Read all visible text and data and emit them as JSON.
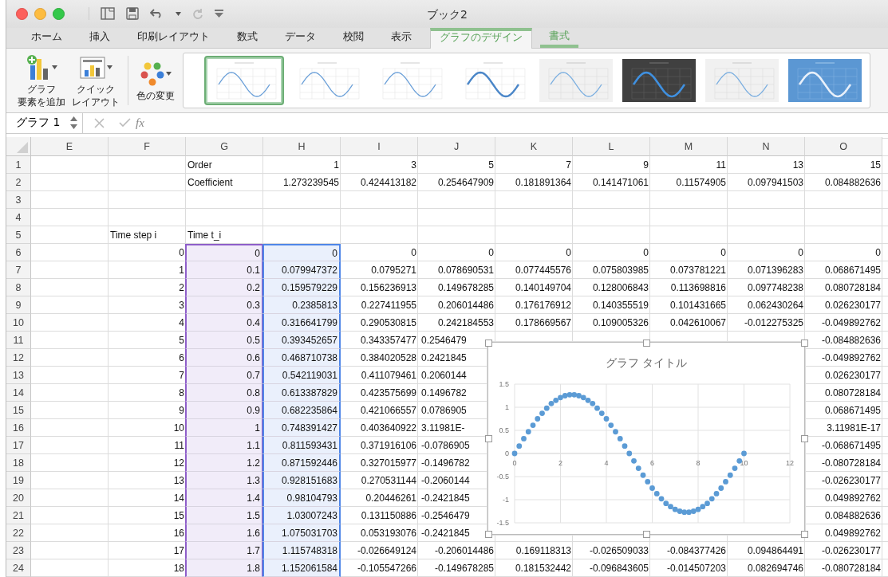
{
  "window": {
    "title": "ブック2"
  },
  "tabs": [
    {
      "label": "ホーム",
      "selected": false,
      "kind": "normal"
    },
    {
      "label": "挿入",
      "selected": false,
      "kind": "normal"
    },
    {
      "label": "印刷レイアウト",
      "selected": false,
      "kind": "normal"
    },
    {
      "label": "数式",
      "selected": false,
      "kind": "normal"
    },
    {
      "label": "データ",
      "selected": false,
      "kind": "normal"
    },
    {
      "label": "校閲",
      "selected": false,
      "kind": "normal"
    },
    {
      "label": "表示",
      "selected": false,
      "kind": "normal"
    },
    {
      "label": "グラフのデザイン",
      "selected": true,
      "kind": "context"
    },
    {
      "label": "書式",
      "selected": false,
      "kind": "context"
    }
  ],
  "ribbon": {
    "buttons": [
      {
        "kind": "add-element",
        "lines": [
          "グラフ",
          "要素を追加"
        ]
      },
      {
        "kind": "quick-layout",
        "lines": [
          "クイック",
          "レイアウト"
        ]
      },
      {
        "kind": "colors",
        "lines": [
          "色の変更"
        ]
      }
    ],
    "styles": [
      {
        "kind": "plain",
        "selected": true
      },
      {
        "kind": "plain",
        "selected": false
      },
      {
        "kind": "plain",
        "selected": false
      },
      {
        "kind": "bold",
        "selected": false
      },
      {
        "kind": "shaded",
        "selected": false
      },
      {
        "kind": "dark",
        "selected": false
      },
      {
        "kind": "shaded",
        "selected": false
      },
      {
        "kind": "blue",
        "selected": false
      }
    ]
  },
  "formula_bar": {
    "name_box": "グラフ 1",
    "fx": "fx"
  },
  "sheet": {
    "columns": [
      {
        "label": "E"
      },
      {
        "label": "F"
      },
      {
        "label": "G",
        "color": "#8e5ec9"
      },
      {
        "label": "H",
        "color": "#4f86e8"
      },
      {
        "label": "I"
      },
      {
        "label": "J"
      },
      {
        "label": "K"
      },
      {
        "label": "L"
      },
      {
        "label": "M"
      },
      {
        "label": "N"
      },
      {
        "label": "O"
      }
    ],
    "rows": [
      {
        "header": "1",
        "cells": {
          "G": {
            "text": "Order",
            "kind": "label"
          },
          "H": "1",
          "I": "3",
          "J": "5",
          "K": "7",
          "L": "9",
          "M": "11",
          "N": "13",
          "O": "15"
        }
      },
      {
        "header": "2",
        "cells": {
          "G": {
            "text": "Coefficient",
            "kind": "label"
          },
          "H": "1.273239545",
          "I": "0.424413182",
          "J": "0.254647909",
          "K": "0.181891364",
          "L": "0.141471061",
          "M": "0.11574905",
          "N": "0.097941503",
          "O": "0.084882636"
        }
      },
      {
        "header": "3",
        "cells": {}
      },
      {
        "header": "4",
        "cells": {}
      },
      {
        "header": "5",
        "cells": {
          "F": {
            "text": "Time step i",
            "kind": "label"
          },
          "G": {
            "text": "Time t_i",
            "kind": "label"
          }
        }
      },
      {
        "header": "6",
        "in_range": true,
        "cells": {
          "F": "0",
          "G": "0",
          "H": "0",
          "I": "0",
          "J": "0",
          "K": "0",
          "L": "0",
          "M": "0",
          "N": "0",
          "O": "0"
        }
      },
      {
        "header": "7",
        "in_range": true,
        "cells": {
          "F": "1",
          "G": "0.1",
          "H": "0.079947372",
          "I": "0.0795271",
          "J": "0.078690531",
          "K": "0.077445576",
          "L": "0.075803985",
          "M": "0.073781221",
          "N": "0.071396283",
          "O": "0.068671495"
        }
      },
      {
        "header": "8",
        "in_range": true,
        "cells": {
          "F": "2",
          "G": "0.2",
          "H": "0.159579229",
          "I": "0.156236913",
          "J": "0.149678285",
          "K": "0.140149704",
          "L": "0.128006843",
          "M": "0.113698816",
          "N": "0.097748238",
          "O": "0.080728184"
        }
      },
      {
        "header": "9",
        "in_range": true,
        "cells": {
          "F": "3",
          "G": "0.3",
          "H": "0.2385813",
          "I": "0.227411955",
          "J": "0.206014486",
          "K": "0.176176912",
          "L": "0.140355519",
          "M": "0.101431665",
          "N": "0.062430264",
          "O": "0.026230177"
        }
      },
      {
        "header": "10",
        "in_range": true,
        "cells": {
          "F": "4",
          "G": "0.4",
          "H": "0.316641799",
          "I": "0.290530815",
          "J": "0.242184553",
          "K": "0.178669567",
          "L": "0.109005326",
          "M": "0.042610067",
          "N": "-0.012275325",
          "O": "-0.049892762"
        }
      },
      {
        "header": "11",
        "in_range": true,
        "cells": {
          "F": "5",
          "G": "0.5",
          "H": "0.393452657",
          "I": "0.343357477",
          "J": {
            "text": "0.2546479",
            "kind": "clipped"
          },
          "O": "-0.084882636"
        }
      },
      {
        "header": "12",
        "in_range": true,
        "cells": {
          "F": "6",
          "G": "0.6",
          "H": "0.468710738",
          "I": "0.384020528",
          "J": {
            "text": "0.2421845",
            "kind": "clipped"
          },
          "O": "-0.049892762"
        }
      },
      {
        "header": "13",
        "in_range": true,
        "cells": {
          "F": "7",
          "G": "0.7",
          "H": "0.542119031",
          "I": "0.411079461",
          "J": {
            "text": "0.2060144",
            "kind": "clipped"
          },
          "O": "0.026230177"
        }
      },
      {
        "header": "14",
        "in_range": true,
        "cells": {
          "F": "8",
          "G": "0.8",
          "H": "0.613387829",
          "I": "0.423575699",
          "J": {
            "text": "0.1496782",
            "kind": "clipped"
          },
          "O": "0.080728184"
        }
      },
      {
        "header": "15",
        "in_range": true,
        "cells": {
          "F": "9",
          "G": "0.9",
          "H": "0.682235864",
          "I": "0.421066557",
          "J": {
            "text": "0.0786905",
            "kind": "clipped"
          },
          "O": "0.068671495"
        }
      },
      {
        "header": "16",
        "in_range": true,
        "cells": {
          "F": "10",
          "G": "1",
          "H": "0.748391427",
          "I": "0.403640922",
          "J": {
            "text": "3.11981E-",
            "kind": "clipped"
          },
          "O": "3.11981E-17"
        }
      },
      {
        "header": "17",
        "in_range": true,
        "cells": {
          "F": "11",
          "G": "1.1",
          "H": "0.811593431",
          "I": "0.371916106",
          "J": {
            "text": "-0.0786905",
            "kind": "clipped"
          },
          "O": "-0.068671495"
        }
      },
      {
        "header": "18",
        "in_range": true,
        "cells": {
          "F": "12",
          "G": "1.2",
          "H": "0.871592446",
          "I": "0.327015977",
          "J": {
            "text": "-0.1496782",
            "kind": "clipped"
          },
          "O": "-0.080728184"
        }
      },
      {
        "header": "19",
        "in_range": true,
        "cells": {
          "F": "13",
          "G": "1.3",
          "H": "0.928151683",
          "I": "0.270531144",
          "J": {
            "text": "-0.2060144",
            "kind": "clipped"
          },
          "O": "-0.026230177"
        }
      },
      {
        "header": "20",
        "in_range": true,
        "cells": {
          "F": "14",
          "G": "1.4",
          "H": "0.98104793",
          "I": "0.20446261",
          "J": {
            "text": "-0.2421845",
            "kind": "clipped"
          },
          "O": "0.049892762"
        }
      },
      {
        "header": "21",
        "in_range": true,
        "cells": {
          "F": "15",
          "G": "1.5",
          "H": "1.03007243",
          "I": "0.131150886",
          "J": {
            "text": "-0.2546479",
            "kind": "clipped"
          },
          "O": "0.084882636"
        }
      },
      {
        "header": "22",
        "in_range": true,
        "cells": {
          "F": "16",
          "G": "1.6",
          "H": "1.075031703",
          "I": "0.053193076",
          "J": {
            "text": "-0.2421845",
            "kind": "clipped"
          },
          "O": "0.049892762"
        }
      },
      {
        "header": "23",
        "in_range": true,
        "cells": {
          "F": "17",
          "G": "1.7",
          "H": "1.115748318",
          "I": "-0.026649124",
          "J": "-0.206014486",
          "K": "0.169118313",
          "L": "-0.026509033",
          "M": "-0.084377426",
          "N": "0.094864491",
          "O": "-0.026230177"
        }
      },
      {
        "header": "24",
        "in_range": true,
        "cells": {
          "F": "18",
          "G": "1.8",
          "H": "1.152061584",
          "I": "-0.105547266",
          "J": "-0.149678285",
          "K": "0.181532442",
          "L": "-0.096843605",
          "M": "-0.014507203",
          "N": "0.082694746",
          "O": "-0.080728184"
        }
      }
    ],
    "chart": {
      "chart_data": {
        "type": "scatter",
        "title": "グラフ タイトル",
        "xlim": [
          0,
          12
        ],
        "ylim": [
          -1.5,
          1.5
        ],
        "grid": true,
        "xticks": [
          {
            "value": 0,
            "label": "0"
          },
          {
            "value": 2,
            "label": "2"
          },
          {
            "value": 4,
            "label": "4"
          },
          {
            "value": 6,
            "label": "6"
          },
          {
            "value": 8,
            "label": "8"
          },
          {
            "value": 10,
            "label": "10"
          },
          {
            "value": 12,
            "label": "12"
          }
        ],
        "yticks": [
          {
            "value": -1.5,
            "label": "-1.5"
          },
          {
            "value": -1,
            "label": "-1"
          },
          {
            "value": -0.5,
            "label": "-0.5"
          },
          {
            "value": 0,
            "label": "0"
          },
          {
            "value": 0.5,
            "label": "0.5"
          },
          {
            "value": 1,
            "label": "1"
          },
          {
            "value": 1.5,
            "label": "1.5"
          }
        ],
        "x": [
          0,
          0.2,
          0.4,
          0.6,
          0.8,
          1,
          1.2,
          1.4,
          1.6,
          1.8,
          2,
          2.2,
          2.4,
          2.6,
          2.8,
          3,
          3.2,
          3.4,
          3.6,
          3.8,
          4,
          4.2,
          4.4,
          4.6,
          4.8,
          5,
          5.2,
          5.4,
          5.6,
          5.8,
          6,
          6.2,
          6.4,
          6.6,
          6.8,
          7,
          7.2,
          7.4,
          7.6,
          7.8,
          8,
          8.2,
          8.4,
          8.6,
          8.8,
          9,
          9.2,
          9.4,
          9.6,
          9.8,
          10
        ],
        "series": [
          {
            "color": "#5b9bd5",
            "values": [
              0,
              0.16,
              0.32,
              0.47,
              0.61,
              0.75,
              0.87,
              0.98,
              1.08,
              1.15,
              1.21,
              1.25,
              1.27,
              1.27,
              1.25,
              1.21,
              1.15,
              1.08,
              0.98,
              0.87,
              0.75,
              0.61,
              0.47,
              0.32,
              0.16,
              0,
              -0.16,
              -0.32,
              -0.47,
              -0.61,
              -0.75,
              -0.87,
              -0.98,
              -1.08,
              -1.15,
              -1.21,
              -1.25,
              -1.27,
              -1.27,
              -1.25,
              -1.21,
              -1.15,
              -1.08,
              -0.98,
              -0.87,
              -0.75,
              -0.61,
              -0.47,
              -0.32,
              -0.16,
              0
            ]
          }
        ]
      }
    }
  }
}
